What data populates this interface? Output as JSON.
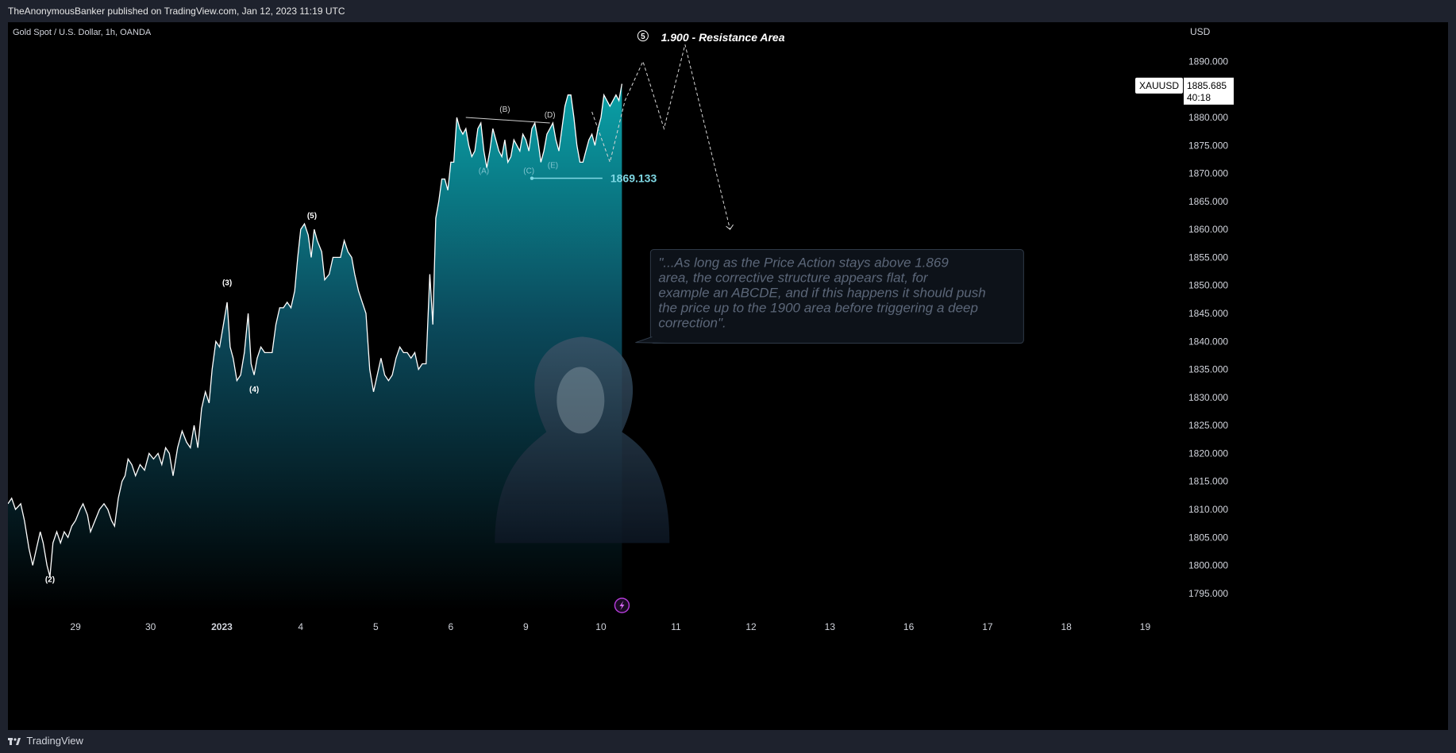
{
  "header": {
    "publish_line": "TheAnonymousBanker published on TradingView.com, Jan 12, 2023 11:19 UTC"
  },
  "footer": {
    "brand": "TradingView"
  },
  "colors": {
    "background": "#000000",
    "frame": "#1e222d",
    "line": "#ffffff",
    "area_top": "#0aa2a8",
    "area_bottom": "#000000",
    "accent": "#7fd8e4",
    "projection": "#d8d8d8",
    "note_text": "#5b6678"
  },
  "chart_data": {
    "type": "area",
    "title": "Gold Spot / U.S. Dollar, 1h, OANDA",
    "currency": "USD",
    "symbol": "XAUUSD",
    "last_price": "1885.685",
    "countdown": "40:18",
    "ylim": [
      1792,
      1897
    ],
    "y_ticks": [
      "1795.000",
      "1800.000",
      "1805.000",
      "1810.000",
      "1815.000",
      "1820.000",
      "1825.000",
      "1830.000",
      "1835.000",
      "1840.000",
      "1845.000",
      "1850.000",
      "1855.000",
      "1860.000",
      "1865.000",
      "1870.000",
      "1875.000",
      "1880.000",
      "1885.000",
      "1890.000"
    ],
    "x_ticks": [
      {
        "label": "29",
        "t": 0.9
      },
      {
        "label": "30",
        "t": 1.9
      },
      {
        "label": "2023",
        "t": 2.85
      },
      {
        "label": "4",
        "t": 3.9
      },
      {
        "label": "5",
        "t": 4.9
      },
      {
        "label": "6",
        "t": 5.9
      },
      {
        "label": "9",
        "t": 6.9
      },
      {
        "label": "10",
        "t": 7.9
      },
      {
        "label": "11",
        "t": 8.9
      },
      {
        "label": "12",
        "t": 9.9
      },
      {
        "label": "13",
        "t": 10.95
      },
      {
        "label": "16",
        "t": 12.0
      },
      {
        "label": "17",
        "t": 13.05
      },
      {
        "label": "18",
        "t": 14.1
      },
      {
        "label": "19",
        "t": 15.15
      }
    ],
    "x_range": [
      0,
      15.6
    ],
    "series": [
      {
        "values": [
          [
            0.0,
            1811
          ],
          [
            0.05,
            1812
          ],
          [
            0.1,
            1810
          ],
          [
            0.17,
            1811
          ],
          [
            0.22,
            1808
          ],
          [
            0.28,
            1803
          ],
          [
            0.33,
            1800
          ],
          [
            0.38,
            1803
          ],
          [
            0.43,
            1806
          ],
          [
            0.47,
            1804
          ],
          [
            0.52,
            1800
          ],
          [
            0.56,
            1798
          ],
          [
            0.6,
            1804
          ],
          [
            0.65,
            1806
          ],
          [
            0.7,
            1804
          ],
          [
            0.75,
            1806
          ],
          [
            0.8,
            1805
          ],
          [
            0.85,
            1807
          ],
          [
            0.9,
            1808
          ],
          [
            0.96,
            1810
          ],
          [
            1.0,
            1811
          ],
          [
            1.06,
            1809
          ],
          [
            1.1,
            1806
          ],
          [
            1.16,
            1808
          ],
          [
            1.22,
            1810
          ],
          [
            1.28,
            1811
          ],
          [
            1.33,
            1810
          ],
          [
            1.38,
            1808
          ],
          [
            1.42,
            1807
          ],
          [
            1.47,
            1812
          ],
          [
            1.52,
            1815
          ],
          [
            1.56,
            1816
          ],
          [
            1.6,
            1819
          ],
          [
            1.65,
            1818
          ],
          [
            1.7,
            1816
          ],
          [
            1.76,
            1818
          ],
          [
            1.82,
            1817
          ],
          [
            1.88,
            1820
          ],
          [
            1.94,
            1819
          ],
          [
            2.0,
            1820
          ],
          [
            2.05,
            1818
          ],
          [
            2.1,
            1821
          ],
          [
            2.15,
            1820
          ],
          [
            2.2,
            1816
          ],
          [
            2.26,
            1821
          ],
          [
            2.32,
            1824
          ],
          [
            2.38,
            1822
          ],
          [
            2.43,
            1821
          ],
          [
            2.48,
            1825
          ],
          [
            2.53,
            1821
          ],
          [
            2.58,
            1828
          ],
          [
            2.63,
            1831
          ],
          [
            2.68,
            1829
          ],
          [
            2.72,
            1835
          ],
          [
            2.77,
            1840
          ],
          [
            2.82,
            1839
          ],
          [
            2.87,
            1843
          ],
          [
            2.92,
            1847
          ],
          [
            2.96,
            1839
          ],
          [
            3.0,
            1837
          ],
          [
            3.05,
            1833
          ],
          [
            3.1,
            1834
          ],
          [
            3.15,
            1838
          ],
          [
            3.2,
            1845
          ],
          [
            3.24,
            1836
          ],
          [
            3.28,
            1834
          ],
          [
            3.32,
            1837
          ],
          [
            3.37,
            1839
          ],
          [
            3.42,
            1838
          ],
          [
            3.47,
            1838
          ],
          [
            3.52,
            1838
          ],
          [
            3.57,
            1843
          ],
          [
            3.62,
            1846
          ],
          [
            3.67,
            1846
          ],
          [
            3.72,
            1847
          ],
          [
            3.77,
            1846
          ],
          [
            3.82,
            1849
          ],
          [
            3.86,
            1855
          ],
          [
            3.9,
            1860
          ],
          [
            3.95,
            1861
          ],
          [
            4.0,
            1859
          ],
          [
            4.04,
            1855
          ],
          [
            4.08,
            1860
          ],
          [
            4.12,
            1858
          ],
          [
            4.18,
            1856
          ],
          [
            4.22,
            1851
          ],
          [
            4.28,
            1852
          ],
          [
            4.33,
            1855
          ],
          [
            4.38,
            1855
          ],
          [
            4.43,
            1855
          ],
          [
            4.48,
            1858
          ],
          [
            4.53,
            1856
          ],
          [
            4.58,
            1855
          ],
          [
            4.62,
            1852
          ],
          [
            4.67,
            1849
          ],
          [
            4.72,
            1847
          ],
          [
            4.77,
            1845
          ],
          [
            4.82,
            1835
          ],
          [
            4.87,
            1831
          ],
          [
            4.92,
            1834
          ],
          [
            4.97,
            1837
          ],
          [
            5.02,
            1834
          ],
          [
            5.07,
            1833
          ],
          [
            5.12,
            1834
          ],
          [
            5.17,
            1837
          ],
          [
            5.22,
            1839
          ],
          [
            5.27,
            1838
          ],
          [
            5.32,
            1838
          ],
          [
            5.37,
            1837
          ],
          [
            5.42,
            1838
          ],
          [
            5.47,
            1835
          ],
          [
            5.52,
            1836
          ],
          [
            5.57,
            1836
          ],
          [
            5.62,
            1852
          ],
          [
            5.66,
            1843
          ],
          [
            5.7,
            1862
          ],
          [
            5.74,
            1865
          ],
          [
            5.78,
            1869
          ],
          [
            5.82,
            1869
          ],
          [
            5.86,
            1867
          ],
          [
            5.9,
            1872
          ],
          [
            5.94,
            1872
          ],
          [
            5.98,
            1880
          ],
          [
            6.02,
            1878
          ],
          [
            6.06,
            1877
          ],
          [
            6.1,
            1878
          ],
          [
            6.14,
            1875
          ],
          [
            6.18,
            1873
          ],
          [
            6.22,
            1874
          ],
          [
            6.26,
            1878
          ],
          [
            6.3,
            1879
          ],
          [
            6.34,
            1874
          ],
          [
            6.38,
            1871
          ],
          [
            6.42,
            1874
          ],
          [
            6.46,
            1878
          ],
          [
            6.5,
            1876
          ],
          [
            6.54,
            1874
          ],
          [
            6.58,
            1873
          ],
          [
            6.62,
            1876
          ],
          [
            6.66,
            1872
          ],
          [
            6.7,
            1873
          ],
          [
            6.74,
            1876
          ],
          [
            6.78,
            1875
          ],
          [
            6.82,
            1874
          ],
          [
            6.86,
            1877
          ],
          [
            6.9,
            1876
          ],
          [
            6.94,
            1874
          ],
          [
            6.98,
            1878
          ],
          [
            7.02,
            1879
          ],
          [
            7.06,
            1876
          ],
          [
            7.1,
            1872
          ],
          [
            7.14,
            1874
          ],
          [
            7.18,
            1877
          ],
          [
            7.22,
            1878
          ],
          [
            7.26,
            1879
          ],
          [
            7.3,
            1876
          ],
          [
            7.34,
            1874
          ],
          [
            7.38,
            1878
          ],
          [
            7.42,
            1882
          ],
          [
            7.46,
            1884
          ],
          [
            7.5,
            1884
          ],
          [
            7.54,
            1880
          ],
          [
            7.58,
            1875
          ],
          [
            7.62,
            1872
          ],
          [
            7.66,
            1872
          ],
          [
            7.7,
            1874
          ],
          [
            7.74,
            1876
          ],
          [
            7.78,
            1877
          ],
          [
            7.82,
            1875
          ],
          [
            7.86,
            1878
          ],
          [
            7.9,
            1880
          ],
          [
            7.94,
            1884
          ],
          [
            7.98,
            1883
          ],
          [
            8.02,
            1882
          ],
          [
            8.06,
            1883
          ],
          [
            8.1,
            1884
          ],
          [
            8.14,
            1883
          ],
          [
            8.18,
            1886
          ]
        ]
      }
    ],
    "wave_labels": [
      {
        "label": "(2)",
        "t": 0.56,
        "y": 1797
      },
      {
        "label": "(3)",
        "t": 2.92,
        "y": 1850
      },
      {
        "label": "(4)",
        "t": 3.28,
        "y": 1831
      },
      {
        "label": "(5)",
        "t": 4.05,
        "y": 1862
      },
      {
        "label": "(A)",
        "t": 6.34,
        "y": 1870
      },
      {
        "label": "(B)",
        "t": 6.62,
        "y": 1881
      },
      {
        "label": "(C)",
        "t": 6.94,
        "y": 1870
      },
      {
        "label": "(D)",
        "t": 7.22,
        "y": 1880
      },
      {
        "label": "(E)",
        "t": 7.26,
        "y": 1871
      },
      {
        "label": "5",
        "t": 8.46,
        "y": 1894
      }
    ],
    "abcde_line": [
      [
        6.1,
        1880
      ],
      [
        7.22,
        1879
      ]
    ],
    "support": {
      "label": "1869.133",
      "value": 1869.133,
      "t_start": 6.98,
      "t_end": 7.92
    },
    "projection_path": [
      [
        7.78,
        1881
      ],
      [
        8.02,
        1872
      ],
      [
        8.22,
        1883
      ],
      [
        8.46,
        1890
      ],
      [
        8.74,
        1878
      ],
      [
        9.02,
        1893
      ],
      [
        9.62,
        1860
      ]
    ],
    "resistance_label": "1.900 - Resistance Area",
    "quote_box_text": "\"...As long as the Price Action stays above 1.869 area, the corrective structure appears flat, for example an ABCDE, and if this happens it should push the price up to the 1900 area before triggering a deep correction\"."
  }
}
